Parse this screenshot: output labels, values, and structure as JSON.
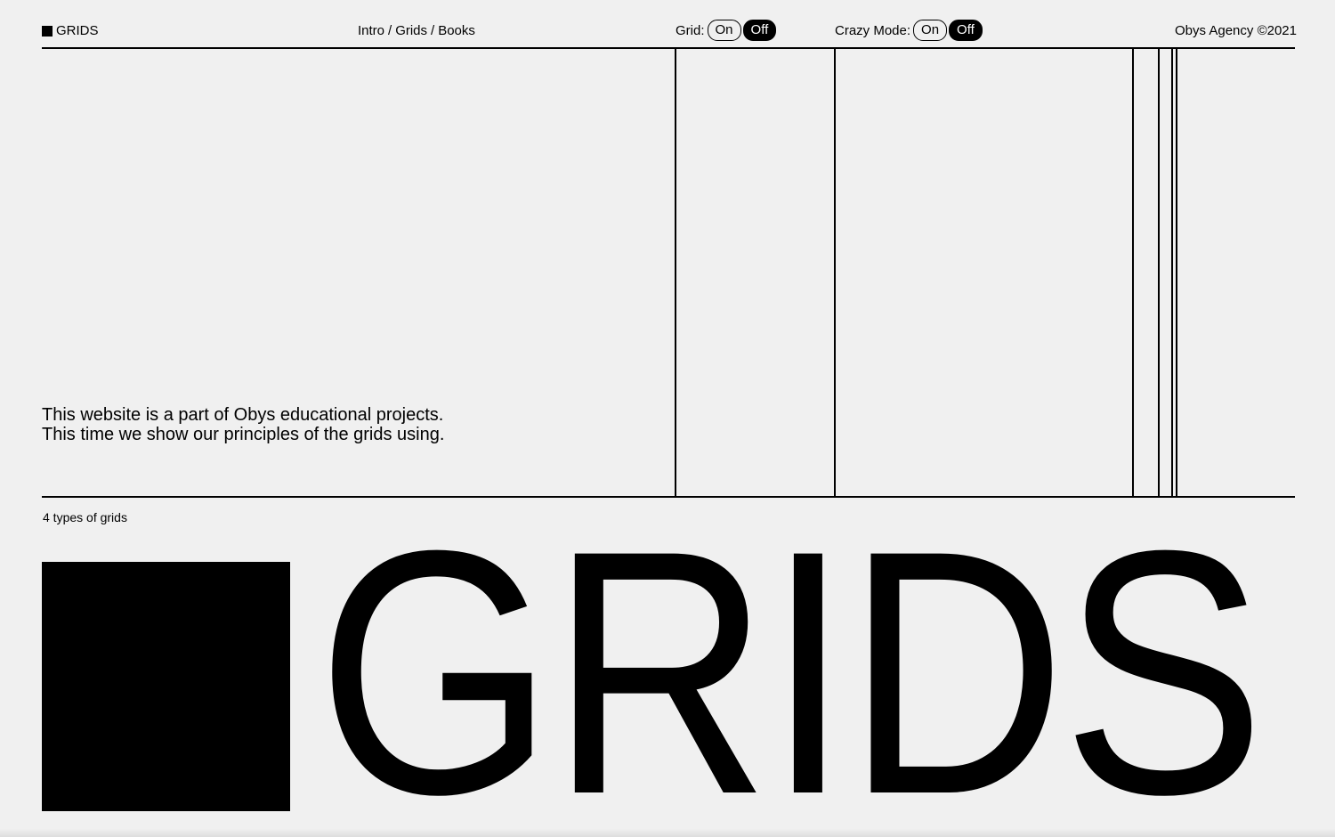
{
  "header": {
    "logo_label": "GRIDS",
    "breadcrumb": [
      "Intro",
      "Grids",
      "Books"
    ],
    "breadcrumb_separator": "/",
    "grid_toggle": {
      "label": "Grid:",
      "on": "On",
      "off": "Off",
      "selected": "Off"
    },
    "crazy_toggle": {
      "label": "Crazy Mode:",
      "on": "On",
      "off": "Off",
      "selected": "Off"
    },
    "copyright": "Obys Agency ©2021"
  },
  "intro": {
    "line1": "This website is a part of Obys educational projects.",
    "line2": "This time we show our principles of the grids using."
  },
  "section": {
    "label": "4 types of grids",
    "big_title": "GRIDS"
  },
  "colors": {
    "background": "#f0f0f0",
    "foreground": "#000000"
  }
}
